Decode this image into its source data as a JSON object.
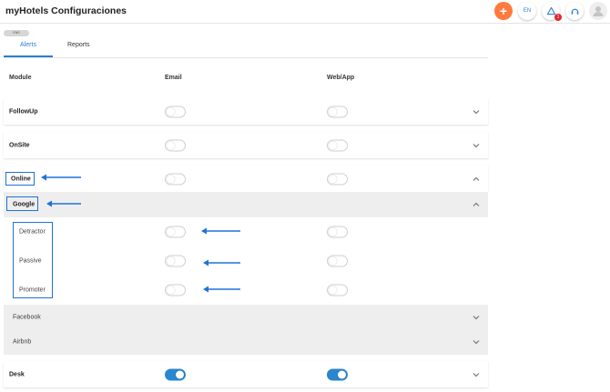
{
  "app": {
    "title": "myHotels Configuraciones"
  },
  "topbar": {
    "language": "EN",
    "notification_count": "1"
  },
  "pill": {
    "label": "ENS"
  },
  "tabs": [
    {
      "label": "Alerts",
      "active": true
    },
    {
      "label": "Reports",
      "active": false
    }
  ],
  "table": {
    "headers": {
      "module": "Module",
      "email": "Email",
      "webapp": "Web/App"
    },
    "rows": {
      "followup": {
        "label": "FollowUp",
        "email": false,
        "web": false,
        "expanded": false
      },
      "onsite": {
        "label": "OnSite",
        "email": false,
        "web": false,
        "expanded": false
      },
      "online": {
        "label": "Online",
        "email": false,
        "web": false,
        "expanded": true
      },
      "google": {
        "label": "Google",
        "expanded": true
      },
      "detractor": {
        "label": "Detractor",
        "email": false,
        "web": false
      },
      "passive": {
        "label": "Passive",
        "email": false,
        "web": false
      },
      "promoter": {
        "label": "Promoter",
        "email": false,
        "web": false
      },
      "facebook": {
        "label": "Facebook",
        "expanded": false
      },
      "airbnb": {
        "label": "Airbnb",
        "expanded": false
      },
      "desk": {
        "label": "Desk",
        "email": true,
        "web": true,
        "expanded": false
      }
    }
  },
  "colors": {
    "accent": "#2a7fd4",
    "annotation": "#1f72d6",
    "plus_button": "#ff7a3d",
    "badge": "#e3262c"
  },
  "icons": [
    "plus-icon",
    "bell-icon",
    "support-icon",
    "user-avatar-icon",
    "chevron-down-icon",
    "chevron-up-icon",
    "arrow-left-icon"
  ]
}
